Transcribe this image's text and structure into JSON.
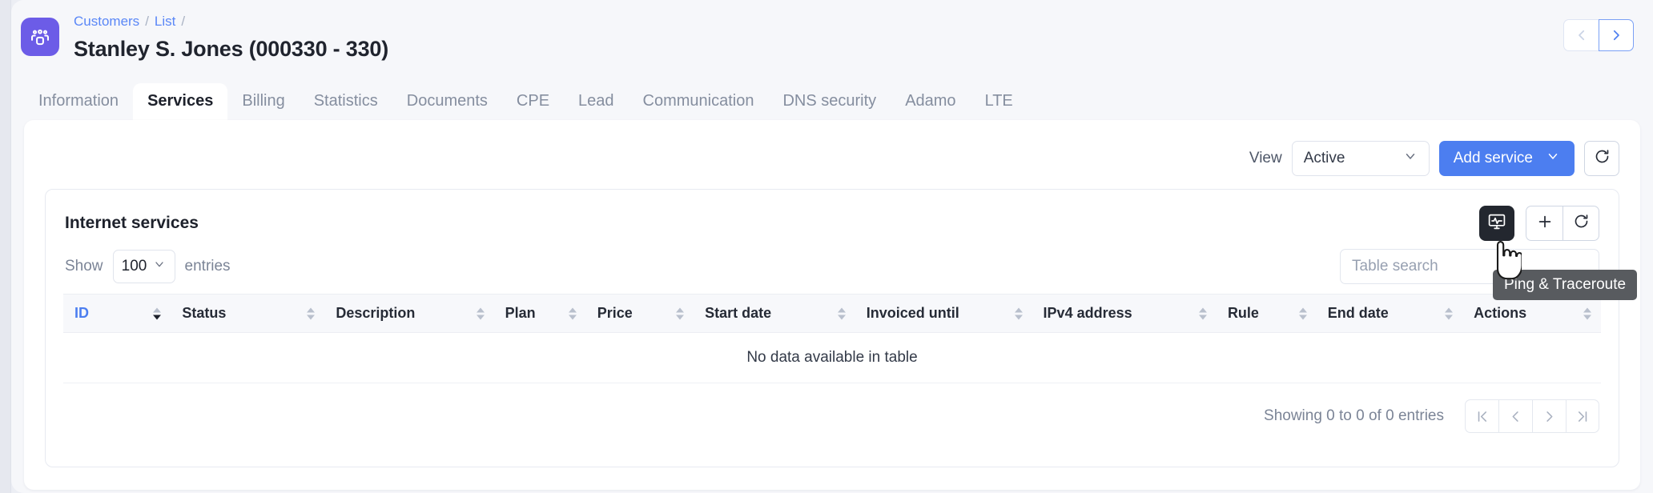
{
  "header": {
    "app_icon": "users-group-icon",
    "breadcrumb": [
      {
        "label": "Customers",
        "link": true
      },
      {
        "label": "List",
        "link": true
      }
    ],
    "breadcrumb_separator": "/",
    "title": "Stanley S. Jones (000330 - 330)",
    "nav": {
      "prev": "‹",
      "next": "›"
    }
  },
  "tabs": [
    {
      "label": "Information",
      "active": false
    },
    {
      "label": "Services",
      "active": true
    },
    {
      "label": "Billing",
      "active": false
    },
    {
      "label": "Statistics",
      "active": false
    },
    {
      "label": "Documents",
      "active": false
    },
    {
      "label": "CPE",
      "active": false
    },
    {
      "label": "Lead",
      "active": false
    },
    {
      "label": "Communication",
      "active": false
    },
    {
      "label": "DNS security",
      "active": false
    },
    {
      "label": "Adamo",
      "active": false
    },
    {
      "label": "LTE",
      "active": false
    }
  ],
  "toolbar": {
    "view_label": "View",
    "view_value": "Active",
    "add_service_label": "Add service",
    "refresh_icon": "refresh-icon"
  },
  "card": {
    "title": "Internet services",
    "ping_button_icon": "monitor-activity-icon",
    "add_button_icon": "plus-icon",
    "refresh_button_icon": "refresh-icon"
  },
  "controls": {
    "show_label": "Show",
    "show_value": "100",
    "entries_label": "entries",
    "search_placeholder": "Table search",
    "search_value": ""
  },
  "table": {
    "columns": [
      {
        "label": "ID",
        "sorted": true
      },
      {
        "label": "Status",
        "sorted": false
      },
      {
        "label": "Description",
        "sorted": false
      },
      {
        "label": "Plan",
        "sorted": false
      },
      {
        "label": "Price",
        "sorted": false
      },
      {
        "label": "Start date",
        "sorted": false
      },
      {
        "label": "Invoiced until",
        "sorted": false
      },
      {
        "label": "IPv4 address",
        "sorted": false
      },
      {
        "label": "Rule",
        "sorted": false
      },
      {
        "label": "End date",
        "sorted": false
      },
      {
        "label": "Actions",
        "sorted": false
      }
    ],
    "rows": [],
    "empty_message": "No data available in table"
  },
  "footer": {
    "showing": "Showing 0 to 0 of 0 entries",
    "pager": [
      {
        "icon": "first-page-icon",
        "glyph": "|‹"
      },
      {
        "icon": "prev-page-icon",
        "glyph": "‹"
      },
      {
        "icon": "next-page-icon",
        "glyph": "›"
      },
      {
        "icon": "last-page-icon",
        "glyph": "›|"
      }
    ]
  },
  "tooltip": {
    "text": "Ping & Traceroute"
  },
  "colors": {
    "accent_blue": "#4c7ef0",
    "brand_purple": "#6c5ce7",
    "page_bg": "#f6f7fa",
    "dark_button": "#23272f",
    "tooltip_bg": "#585b5f"
  }
}
